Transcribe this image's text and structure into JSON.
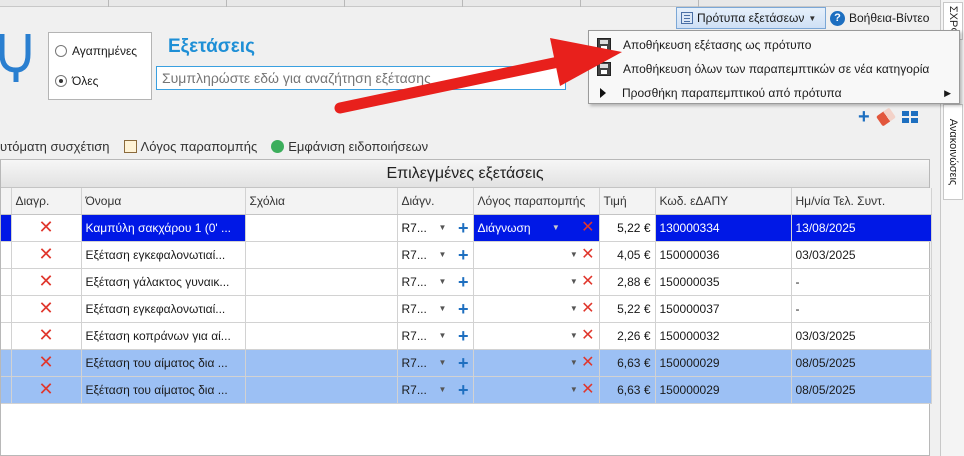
{
  "header": {
    "templates_button": "Πρότυπα εξετάσεων",
    "help_button": "Βοήθεια-Βίντεο"
  },
  "right_strip": {
    "tab_top": "ΣΧΡΦ",
    "tab_middle": "Ανακοινώσεις"
  },
  "filter": {
    "favorites": "Αγαπημένες",
    "all": "Όλες",
    "selected": "all"
  },
  "page_title": "Εξετάσεις",
  "search": {
    "placeholder": "Συμπληρώστε εδώ για αναζήτηση εξέτασης"
  },
  "toolbar": {
    "auto_link": "υτόματη συσχέτιση",
    "referral_reason": "Λόγος παραπομπής",
    "show_notifications": "Εμφάνιση ειδοποιήσεων"
  },
  "menu": {
    "item1": "Αποθήκευση εξέτασης ως πρότυπο",
    "item2": "Αποθήκευση όλων των παραπεμπτικών σε νέα κατηγορία",
    "item3": "Προσθήκη παραπεμπτικού από πρότυπα"
  },
  "grid": {
    "title": "Επιλεγμένες εξετάσεις",
    "columns": {
      "delete": "Διαγρ.",
      "name": "Όνομα",
      "comments": "Σχόλια",
      "diagnosis": "Διάγν.",
      "reason": "Λόγος παραπομπής",
      "price": "Τιμή",
      "code": "Κωδ. εΔΑΠΥ",
      "last_date": "Ημ/νία Τελ. Συντ."
    },
    "rows": [
      {
        "name": "Καμπύλη σακχάρου 1 (0' ...",
        "diagnosis": "R7...",
        "reason": "Διάγνωση",
        "price": "5,22 €",
        "code": "130000334",
        "last_date": "13/08/2025"
      },
      {
        "name": "Εξέταση εγκεφαλονωτιαί...",
        "diagnosis": "R7...",
        "reason": "",
        "price": "4,05 €",
        "code": "150000036",
        "last_date": "03/03/2025"
      },
      {
        "name": "Εξέταση γάλακτος γυναικ...",
        "diagnosis": "R7...",
        "reason": "",
        "price": "2,88 €",
        "code": "150000035",
        "last_date": "-"
      },
      {
        "name": "Εξέταση εγκεφαλονωτιαί...",
        "diagnosis": "R7...",
        "reason": "",
        "price": "5,22 €",
        "code": "150000037",
        "last_date": "-"
      },
      {
        "name": "Εξέταση κοπράνων για αί...",
        "diagnosis": "R7...",
        "reason": "",
        "price": "2,26 €",
        "code": "150000032",
        "last_date": "03/03/2025"
      },
      {
        "name": "Εξέταση του αίματος δια ...",
        "diagnosis": "R7...",
        "reason": "",
        "price": "6,63 €",
        "code": "150000029",
        "last_date": "08/05/2025"
      },
      {
        "name": "Εξέταση του αίματος δια ...",
        "diagnosis": "R7...",
        "reason": "",
        "price": "6,63 €",
        "code": "150000029",
        "last_date": "08/05/2025"
      }
    ]
  },
  "colors": {
    "accent": "#1e8fd6",
    "selected_row": "#0018e6",
    "multi_selected_row": "#9cc0f4",
    "delete_red": "#e0362c",
    "annotation_arrow": "#e8201c"
  }
}
